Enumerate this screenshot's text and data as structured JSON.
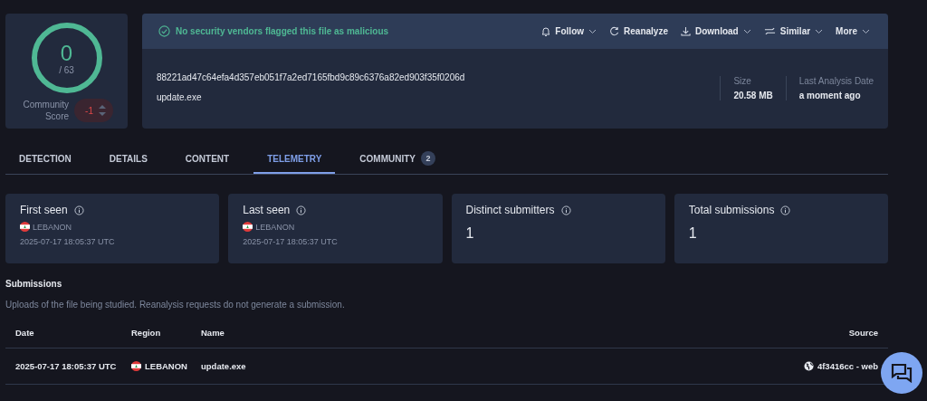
{
  "score": {
    "detections": "0",
    "total": "/ 63",
    "community_label": "Community Score",
    "community_value": "-1"
  },
  "header": {
    "verdict": "No security vendors flagged this file as malicious",
    "actions": [
      {
        "label": "Follow",
        "kind": "follow",
        "dropdown": true
      },
      {
        "label": "Reanalyze",
        "kind": "reanalyze",
        "dropdown": false
      },
      {
        "label": "Download",
        "kind": "download",
        "dropdown": true
      },
      {
        "label": "Similar",
        "kind": "similar",
        "dropdown": true
      },
      {
        "label": "More",
        "kind": "more",
        "dropdown": true
      }
    ],
    "hash": "88221ad47c64efa4d357eb051f7a2ed7165fbd9c89c6376a82ed903f35f0206d",
    "filename": "update.exe",
    "meta": [
      {
        "label": "Size",
        "value": "20.58 MB"
      },
      {
        "label": "Last Analysis Date",
        "value": "a moment ago"
      }
    ]
  },
  "tabs": [
    {
      "label": "DETECTION",
      "selected": false
    },
    {
      "label": "DETAILS",
      "selected": false
    },
    {
      "label": "CONTENT",
      "selected": false
    },
    {
      "label": "TELEMETRY",
      "selected": true
    },
    {
      "label": "COMMUNITY",
      "selected": false,
      "badge": "2"
    }
  ],
  "stats": [
    {
      "kind": "location",
      "title": "First seen",
      "country": "LEBANON",
      "date": "2025-07-17 18:05:37 UTC"
    },
    {
      "kind": "location",
      "title": "Last seen",
      "country": "LEBANON",
      "date": "2025-07-17 18:05:37 UTC"
    },
    {
      "kind": "count",
      "title": "Distinct submitters",
      "value": "1"
    },
    {
      "kind": "count",
      "title": "Total submissions",
      "value": "1"
    }
  ],
  "submissions": {
    "title": "Submissions",
    "description": "Uploads of the file being studied. Reanalysis requests do not generate a submission.",
    "columns": [
      "Date",
      "Region",
      "Name",
      "Source"
    ],
    "rows": [
      {
        "date": "2025-07-17 18:05:37 UTC",
        "region": "LEBANON",
        "name": "update.exe",
        "source": "4f3416cc - web"
      }
    ]
  }
}
